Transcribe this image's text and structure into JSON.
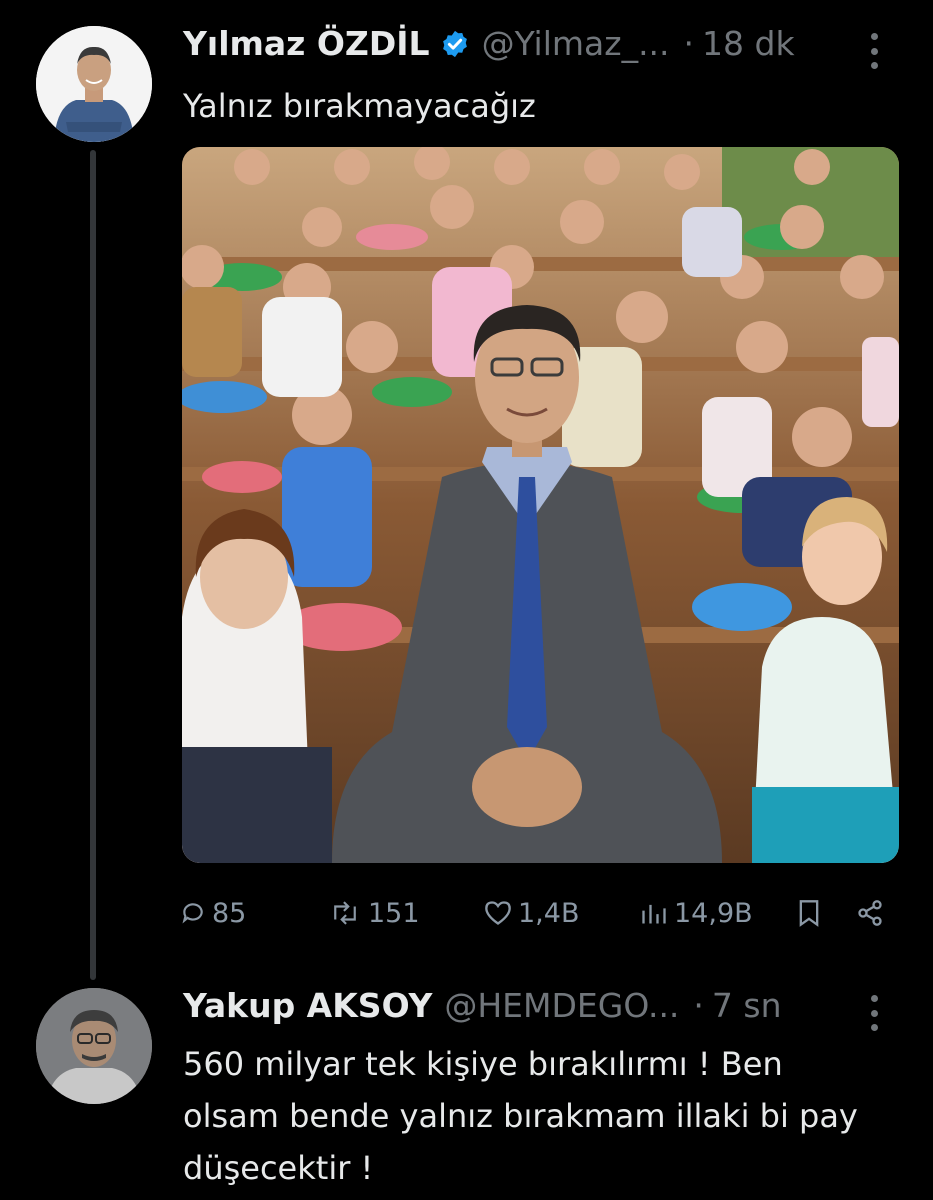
{
  "tweet1": {
    "name": "Yılmaz ÖZDİL",
    "handle": "@Yilmaz_...",
    "time_sep": "·",
    "time": "18 dk",
    "text": "Yalnız bırakmayacağız",
    "verified": true,
    "stats": {
      "replies": "85",
      "retweets": "151",
      "likes": "1,4B",
      "views": "14,9B"
    }
  },
  "tweet2": {
    "name": "Yakup AKSOY",
    "handle": "@HEMDEGO...",
    "time_sep": "·",
    "time": "7 sn",
    "text": "560 milyar tek kişiye bırakılırmı ! Ben olsam bende yalnız bırakmam illaki bi pay düşecektir !"
  },
  "icons": [
    "more-icon",
    "verified-icon",
    "reply-icon",
    "retweet-icon",
    "like-icon",
    "views-icon",
    "bookmark-icon",
    "share-icon"
  ],
  "colors": {
    "background": "#000000",
    "text": "#e7e9ea",
    "secondary": "#71767b",
    "verified": "#1d9bf0",
    "thread_line": "#333639"
  }
}
